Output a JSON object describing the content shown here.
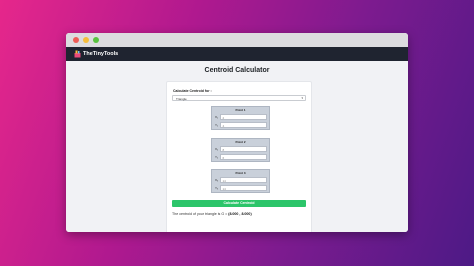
{
  "brand": {
    "name": "TheTinyTools"
  },
  "page": {
    "title": "Centroid Calculator"
  },
  "form": {
    "calculate_label": "Calculate Centroid for :",
    "shape_selected": "Triangle",
    "points": [
      {
        "title": "Point 1",
        "x_label": "X₁",
        "y_label": "Y₁",
        "x_value": "2",
        "y_value": "4"
      },
      {
        "title": "Point 2",
        "x_label": "X₂",
        "y_label": "Y₂",
        "x_value": "8",
        "y_value": "6"
      },
      {
        "title": "Point 3",
        "x_label": "X₃",
        "y_label": "Y₃",
        "x_value": "14",
        "y_value": "14"
      }
    ],
    "button_label": "Calculate Centroid"
  },
  "result": {
    "prefix": "The centroid of your triangle is G = ",
    "x": "8.000",
    "separator": " , ",
    "y": "8.000",
    "open": "(",
    "close": ")"
  },
  "colors": {
    "button": "#2cc56a",
    "navbar": "#1f2430",
    "point_box": "#c9d0da"
  }
}
